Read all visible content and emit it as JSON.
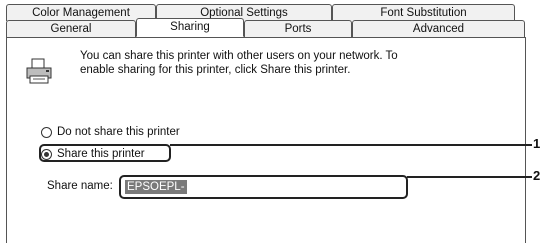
{
  "tabs_row1": [
    {
      "label": "Color Management"
    },
    {
      "label": "Optional Settings"
    },
    {
      "label": "Font Substitution"
    }
  ],
  "tabs_row2": [
    {
      "label": "General"
    },
    {
      "label": "Sharing",
      "active": true
    },
    {
      "label": "Ports"
    },
    {
      "label": "Advanced"
    }
  ],
  "sharing": {
    "description": "You can share this printer with other users on your network.  To enable sharing for this printer, click Share this printer.",
    "option_do_not_share": {
      "label": "Do not share this printer",
      "selected": false
    },
    "option_share": {
      "label": "Share this printer",
      "selected": true
    },
    "share_name_label": "Share name:",
    "share_name_value": "EPSOEPL-"
  },
  "callouts": [
    "1",
    "2"
  ]
}
